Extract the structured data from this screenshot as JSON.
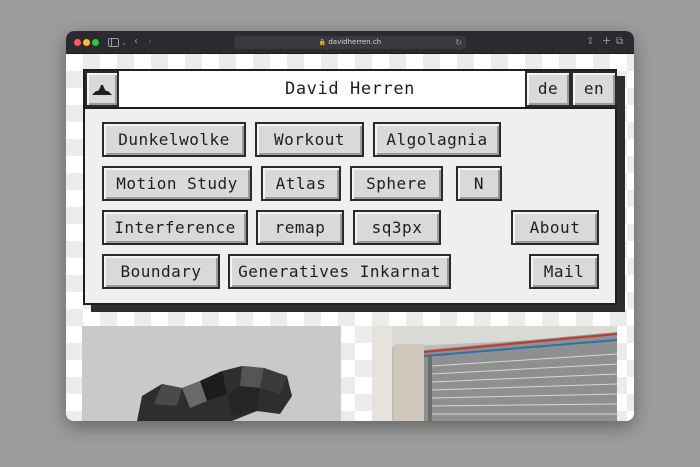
{
  "browser": {
    "url": "davidherren.ch",
    "colors": {
      "titlebar": "#2b2a30",
      "close": "#ff5f57",
      "minimize": "#febc2e",
      "maximize": "#28c840"
    }
  },
  "site": {
    "title": "David Herren",
    "logo_icon": "mountain-icon",
    "languages": [
      "de",
      "en"
    ],
    "nav": {
      "row1": [
        "Dunkelwolke",
        "Workout",
        "Algolagnia"
      ],
      "row2": [
        "Motion Study",
        "Atlas",
        "Sphere",
        "N"
      ],
      "row3": [
        "Interference",
        "remap",
        "sq3px"
      ],
      "row4": [
        "Boundary",
        "Generatives Inkarnat"
      ],
      "about": "About",
      "mail": "Mail"
    }
  }
}
